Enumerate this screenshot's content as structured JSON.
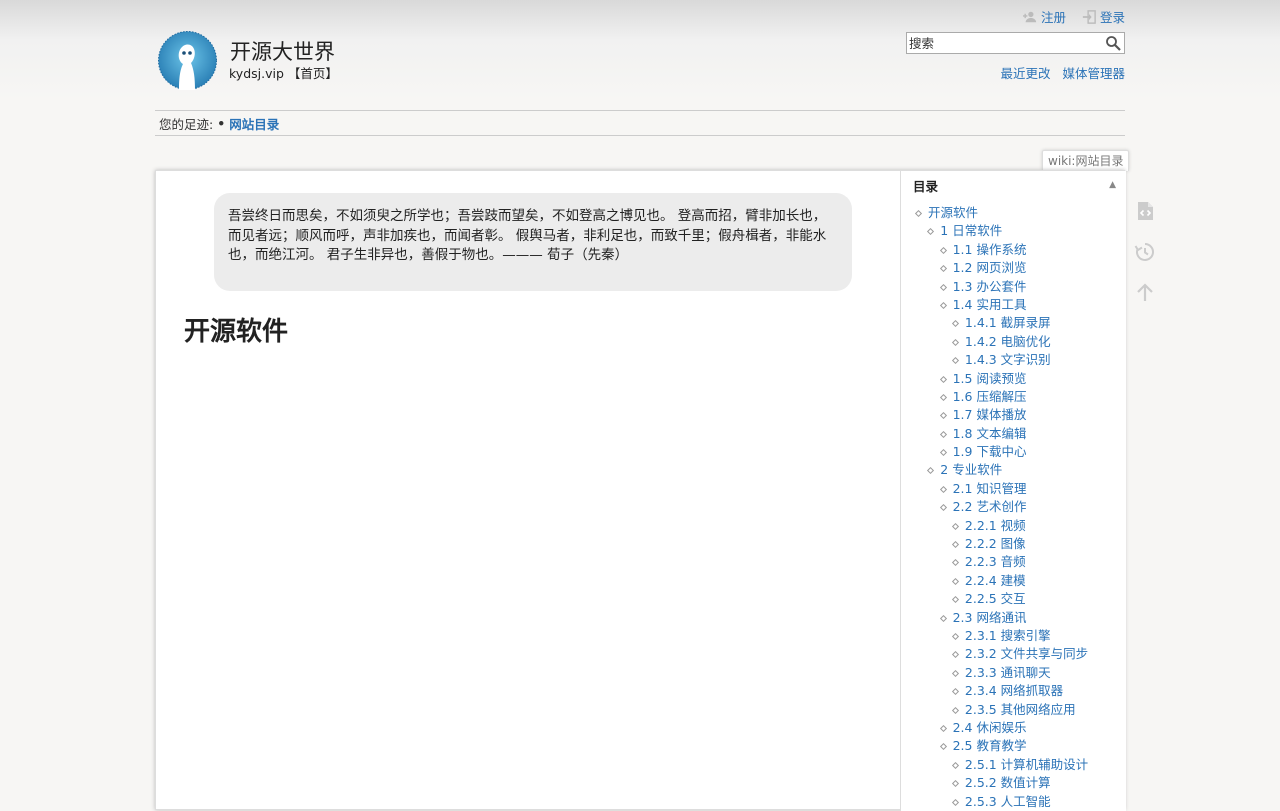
{
  "usertools": {
    "register": "注册",
    "login": "登录"
  },
  "header": {
    "title": "开源大世界",
    "tagline": "kydsj.vip 【首页】"
  },
  "search": {
    "placeholder": "搜索"
  },
  "sitetools": {
    "recent": "最近更改",
    "media": "媒体管理器"
  },
  "breadcrumbs": {
    "label": "您的足迹:",
    "sep": "•",
    "current": "网站目录"
  },
  "pageid": "wiki:网站目录",
  "quote": "吾尝终日而思矣，不如须臾之所学也；吾尝跂而望矣，不如登高之博见也。 登高而招，臂非加长也，而见者远；顺风而呼，声非加疾也，而闻者彰。 假舆马者，非利足也，而致千里；假舟楫者，非能水也，而绝江河。 君子生非异也，善假于物也。——— 荀子（先秦）",
  "heading": "开源软件",
  "toc": {
    "title": "目录",
    "toggle": "▲",
    "items": [
      {
        "label": "开源软件",
        "level": 0
      },
      {
        "label": "1 日常软件",
        "level": 1
      },
      {
        "label": "1.1 操作系统",
        "level": 2
      },
      {
        "label": "1.2 网页浏览",
        "level": 2
      },
      {
        "label": "1.3 办公套件",
        "level": 2
      },
      {
        "label": "1.4 实用工具",
        "level": 2
      },
      {
        "label": "1.4.1 截屏录屏",
        "level": 3
      },
      {
        "label": "1.4.2 电脑优化",
        "level": 3
      },
      {
        "label": "1.4.3 文字识别",
        "level": 3
      },
      {
        "label": "1.5 阅读预览",
        "level": 2
      },
      {
        "label": "1.6 压缩解压",
        "level": 2
      },
      {
        "label": "1.7 媒体播放",
        "level": 2
      },
      {
        "label": "1.8 文本编辑",
        "level": 2
      },
      {
        "label": "1.9 下载中心",
        "level": 2
      },
      {
        "label": "2 专业软件",
        "level": 1
      },
      {
        "label": "2.1 知识管理",
        "level": 2
      },
      {
        "label": "2.2 艺术创作",
        "level": 2
      },
      {
        "label": "2.2.1 视频",
        "level": 3
      },
      {
        "label": "2.2.2 图像",
        "level": 3
      },
      {
        "label": "2.2.3 音频",
        "level": 3
      },
      {
        "label": "2.2.4 建模",
        "level": 3
      },
      {
        "label": "2.2.5 交互",
        "level": 3
      },
      {
        "label": "2.3 网络通讯",
        "level": 2
      },
      {
        "label": "2.3.1 搜索引擎",
        "level": 3
      },
      {
        "label": "2.3.2 文件共享与同步",
        "level": 3
      },
      {
        "label": "2.3.3 通讯聊天",
        "level": 3
      },
      {
        "label": "2.3.4 网络抓取器",
        "level": 3
      },
      {
        "label": "2.3.5 其他网络应用",
        "level": 3
      },
      {
        "label": "2.4 休闲娱乐",
        "level": 2
      },
      {
        "label": "2.5 教育教学",
        "level": 2
      },
      {
        "label": "2.5.1 计算机辅助设计",
        "level": 3
      },
      {
        "label": "2.5.2 数值计算",
        "level": 3
      },
      {
        "label": "2.5.3 人工智能",
        "level": 3
      }
    ]
  },
  "pagetools": [
    {
      "icon": "show-source-icon"
    },
    {
      "icon": "old-revisions-icon"
    },
    {
      "icon": "back-to-top-icon"
    }
  ]
}
